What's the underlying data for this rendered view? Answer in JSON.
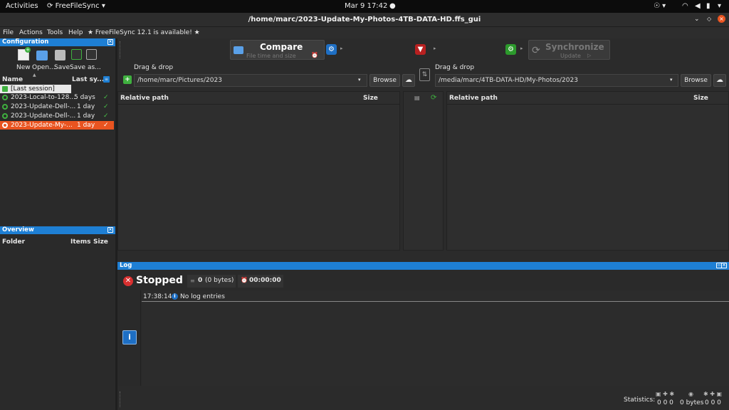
{
  "topbar": {
    "activities": "Activities",
    "app": "FreeFileSync",
    "datetime": "Mar 9  17:42"
  },
  "window": {
    "title": "/home/marc/2023-Update-My-Photos-4TB-DATA-HD.ffs_gui"
  },
  "menu": {
    "file": "File",
    "actions": "Actions",
    "tools": "Tools",
    "help": "Help",
    "update_notice": "★ FreeFileSync 12.1 is available! ★"
  },
  "configuration": {
    "header": "Configuration",
    "buttons": {
      "new": "New",
      "open": "Open...",
      "save": "Save",
      "save_as": "Save as..."
    },
    "columns": {
      "name": "Name",
      "last_sync": "Last sy..."
    },
    "last_session": "[Last session]",
    "items": [
      {
        "name": "2023-Local-to-128...",
        "age": "5 days"
      },
      {
        "name": "2023-Update-Dell-...",
        "age": "1 day"
      },
      {
        "name": "2023-Update-Dell-...",
        "age": "1 day"
      },
      {
        "name": "2023-Update-My-...",
        "age": "1 day"
      }
    ]
  },
  "overview": {
    "header": "Overview",
    "columns": {
      "folder": "Folder",
      "items": "Items",
      "size": "Size"
    }
  },
  "toolbar": {
    "compare_label": "Compare",
    "compare_sub": "File time and size",
    "sync_label": "Synchronize",
    "sync_sub": "Update"
  },
  "left_folder": {
    "drag_label": "Drag & drop",
    "path": "/home/marc/Pictures/2023",
    "browse": "Browse"
  },
  "right_folder": {
    "drag_label": "Drag & drop",
    "path": "/media/marc/4TB-DATA-HD/My-Photos/2023",
    "browse": "Browse"
  },
  "grid": {
    "left": {
      "relative_path": "Relative path",
      "size": "Size"
    },
    "right": {
      "relative_path": "Relative path",
      "size": "Size"
    }
  },
  "log": {
    "header": "Log",
    "status": "Stopped",
    "items": "0",
    "bytes": "(0 bytes)",
    "time": "00:00:00",
    "entry_time": "17:38:14",
    "entry_text": "No log entries"
  },
  "statusbar": {
    "statistics": "Statistics:",
    "counts_left": "0  0  0",
    "bytes": "0 bytes",
    "counts_right": "0  0  0"
  }
}
